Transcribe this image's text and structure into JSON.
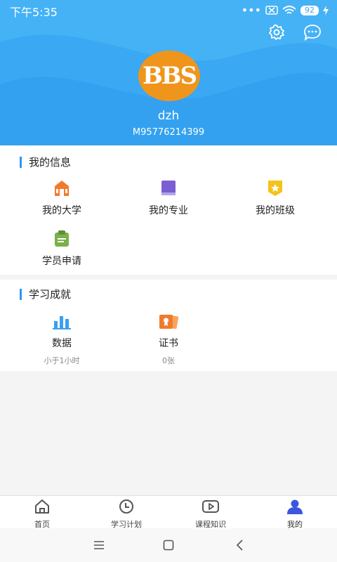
{
  "status": {
    "time": "下午5:35",
    "battery": "92"
  },
  "profile": {
    "avatar_text": "BBS",
    "username": "dzh",
    "user_id": "M95776214399"
  },
  "info": {
    "title": "我的信息",
    "items": [
      {
        "label": "我的大学",
        "icon": "university-icon"
      },
      {
        "label": "我的专业",
        "icon": "book-icon"
      },
      {
        "label": "我的班级",
        "icon": "class-badge-icon"
      },
      {
        "label": "学员申请",
        "icon": "clipboard-icon"
      }
    ]
  },
  "achievements": {
    "title": "学习成就",
    "items": [
      {
        "label": "数据",
        "sub": "小于1小时",
        "icon": "bar-chart-icon"
      },
      {
        "label": "证书",
        "sub": "0张",
        "icon": "certificate-icon"
      }
    ]
  },
  "tabs": [
    {
      "label": "首页",
      "icon": "home-icon"
    },
    {
      "label": "学习计划",
      "icon": "clock-icon"
    },
    {
      "label": "课程知识",
      "icon": "video-icon"
    },
    {
      "label": "我的",
      "icon": "person-icon"
    }
  ],
  "colors": {
    "header": "#3aa8f2",
    "accent": "#2f96ef",
    "avatar": "#f0951c"
  }
}
